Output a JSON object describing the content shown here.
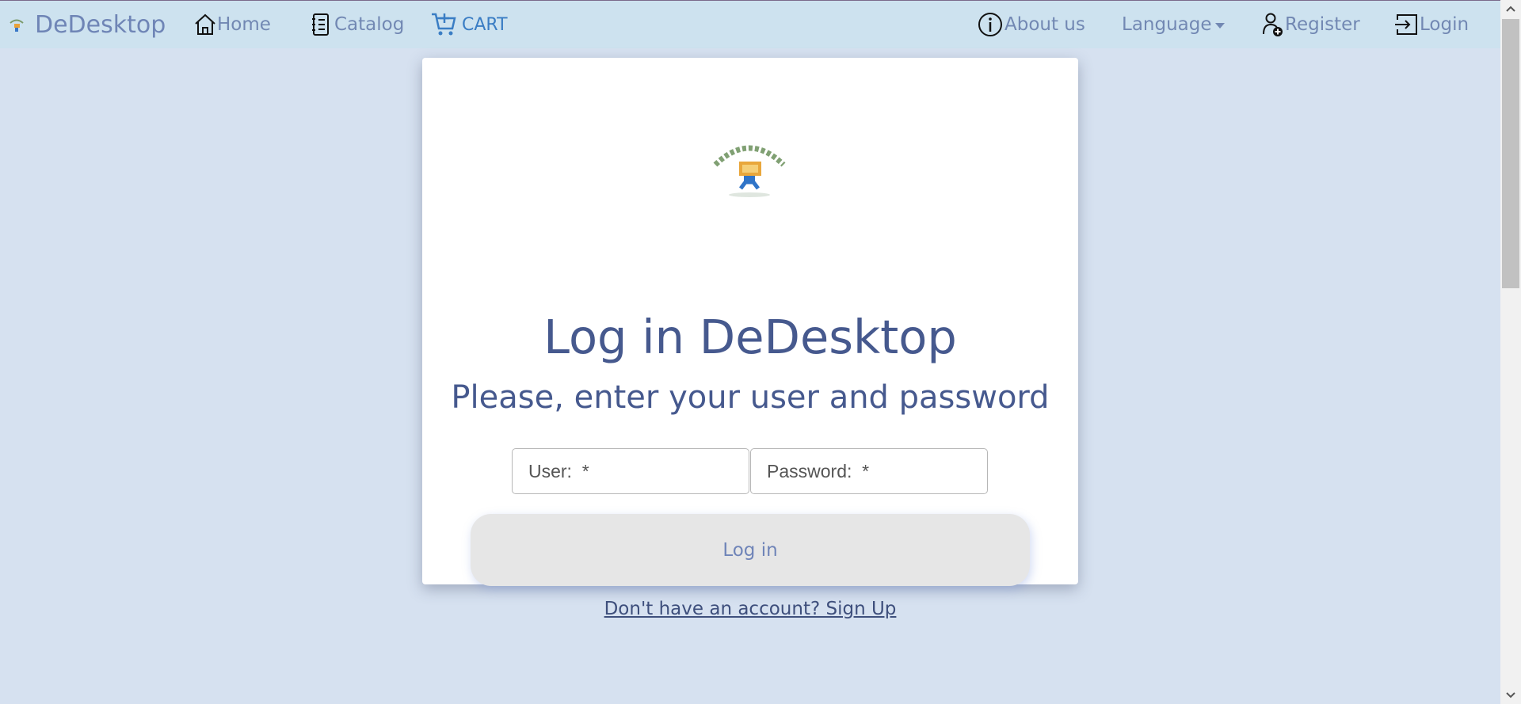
{
  "navbar": {
    "brand": "DeDesktop",
    "home": "Home",
    "catalog": "Catalog",
    "cart": "CART",
    "about": "About us",
    "language": "Language",
    "register": "Register",
    "login": "Login"
  },
  "login_card": {
    "title": "Log in DeDesktop",
    "subtitle": "Please, enter your user and password",
    "user_placeholder": "User:  *",
    "password_placeholder": "Password:  *",
    "login_button": "Log in",
    "signup_link": "Don't have an account? Sign Up"
  },
  "colors": {
    "page_background": "#d6e1f0",
    "navbar_background": "#cde2ef",
    "nav_text": "#7288b3",
    "cart_text": "#3a7dc4",
    "heading_text": "#46598e",
    "button_background": "#e6e6e6"
  },
  "icons": {
    "brand": "dedesktop-logo-icon",
    "home": "home-icon",
    "catalog": "catalog-list-icon",
    "cart": "cart-icon",
    "about": "info-icon",
    "register": "add-user-icon",
    "login": "login-icon"
  }
}
